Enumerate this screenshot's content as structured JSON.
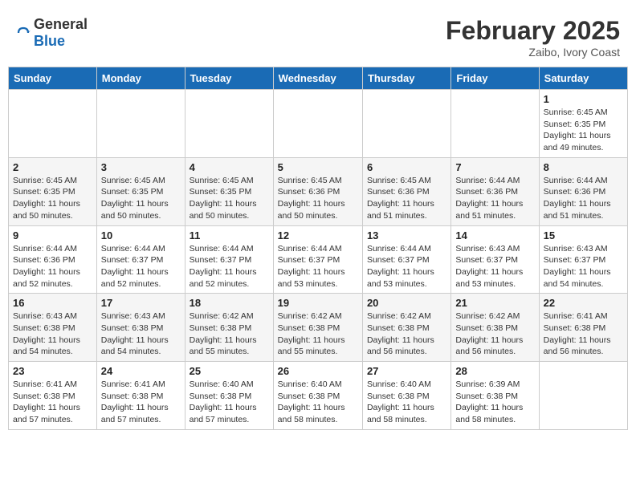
{
  "logo": {
    "general": "General",
    "blue": "Blue"
  },
  "title": "February 2025",
  "location": "Zaibo, Ivory Coast",
  "days": [
    "Sunday",
    "Monday",
    "Tuesday",
    "Wednesday",
    "Thursday",
    "Friday",
    "Saturday"
  ],
  "weeks": [
    [
      {
        "day": "",
        "info": ""
      },
      {
        "day": "",
        "info": ""
      },
      {
        "day": "",
        "info": ""
      },
      {
        "day": "",
        "info": ""
      },
      {
        "day": "",
        "info": ""
      },
      {
        "day": "",
        "info": ""
      },
      {
        "day": "1",
        "info": "Sunrise: 6:45 AM\nSunset: 6:35 PM\nDaylight: 11 hours and 49 minutes."
      }
    ],
    [
      {
        "day": "2",
        "info": "Sunrise: 6:45 AM\nSunset: 6:35 PM\nDaylight: 11 hours and 50 minutes."
      },
      {
        "day": "3",
        "info": "Sunrise: 6:45 AM\nSunset: 6:35 PM\nDaylight: 11 hours and 50 minutes."
      },
      {
        "day": "4",
        "info": "Sunrise: 6:45 AM\nSunset: 6:35 PM\nDaylight: 11 hours and 50 minutes."
      },
      {
        "day": "5",
        "info": "Sunrise: 6:45 AM\nSunset: 6:36 PM\nDaylight: 11 hours and 50 minutes."
      },
      {
        "day": "6",
        "info": "Sunrise: 6:45 AM\nSunset: 6:36 PM\nDaylight: 11 hours and 51 minutes."
      },
      {
        "day": "7",
        "info": "Sunrise: 6:44 AM\nSunset: 6:36 PM\nDaylight: 11 hours and 51 minutes."
      },
      {
        "day": "8",
        "info": "Sunrise: 6:44 AM\nSunset: 6:36 PM\nDaylight: 11 hours and 51 minutes."
      }
    ],
    [
      {
        "day": "9",
        "info": "Sunrise: 6:44 AM\nSunset: 6:36 PM\nDaylight: 11 hours and 52 minutes."
      },
      {
        "day": "10",
        "info": "Sunrise: 6:44 AM\nSunset: 6:37 PM\nDaylight: 11 hours and 52 minutes."
      },
      {
        "day": "11",
        "info": "Sunrise: 6:44 AM\nSunset: 6:37 PM\nDaylight: 11 hours and 52 minutes."
      },
      {
        "day": "12",
        "info": "Sunrise: 6:44 AM\nSunset: 6:37 PM\nDaylight: 11 hours and 53 minutes."
      },
      {
        "day": "13",
        "info": "Sunrise: 6:44 AM\nSunset: 6:37 PM\nDaylight: 11 hours and 53 minutes."
      },
      {
        "day": "14",
        "info": "Sunrise: 6:43 AM\nSunset: 6:37 PM\nDaylight: 11 hours and 53 minutes."
      },
      {
        "day": "15",
        "info": "Sunrise: 6:43 AM\nSunset: 6:37 PM\nDaylight: 11 hours and 54 minutes."
      }
    ],
    [
      {
        "day": "16",
        "info": "Sunrise: 6:43 AM\nSunset: 6:38 PM\nDaylight: 11 hours and 54 minutes."
      },
      {
        "day": "17",
        "info": "Sunrise: 6:43 AM\nSunset: 6:38 PM\nDaylight: 11 hours and 54 minutes."
      },
      {
        "day": "18",
        "info": "Sunrise: 6:42 AM\nSunset: 6:38 PM\nDaylight: 11 hours and 55 minutes."
      },
      {
        "day": "19",
        "info": "Sunrise: 6:42 AM\nSunset: 6:38 PM\nDaylight: 11 hours and 55 minutes."
      },
      {
        "day": "20",
        "info": "Sunrise: 6:42 AM\nSunset: 6:38 PM\nDaylight: 11 hours and 56 minutes."
      },
      {
        "day": "21",
        "info": "Sunrise: 6:42 AM\nSunset: 6:38 PM\nDaylight: 11 hours and 56 minutes."
      },
      {
        "day": "22",
        "info": "Sunrise: 6:41 AM\nSunset: 6:38 PM\nDaylight: 11 hours and 56 minutes."
      }
    ],
    [
      {
        "day": "23",
        "info": "Sunrise: 6:41 AM\nSunset: 6:38 PM\nDaylight: 11 hours and 57 minutes."
      },
      {
        "day": "24",
        "info": "Sunrise: 6:41 AM\nSunset: 6:38 PM\nDaylight: 11 hours and 57 minutes."
      },
      {
        "day": "25",
        "info": "Sunrise: 6:40 AM\nSunset: 6:38 PM\nDaylight: 11 hours and 57 minutes."
      },
      {
        "day": "26",
        "info": "Sunrise: 6:40 AM\nSunset: 6:38 PM\nDaylight: 11 hours and 58 minutes."
      },
      {
        "day": "27",
        "info": "Sunrise: 6:40 AM\nSunset: 6:38 PM\nDaylight: 11 hours and 58 minutes."
      },
      {
        "day": "28",
        "info": "Sunrise: 6:39 AM\nSunset: 6:38 PM\nDaylight: 11 hours and 58 minutes."
      },
      {
        "day": "",
        "info": ""
      }
    ]
  ]
}
